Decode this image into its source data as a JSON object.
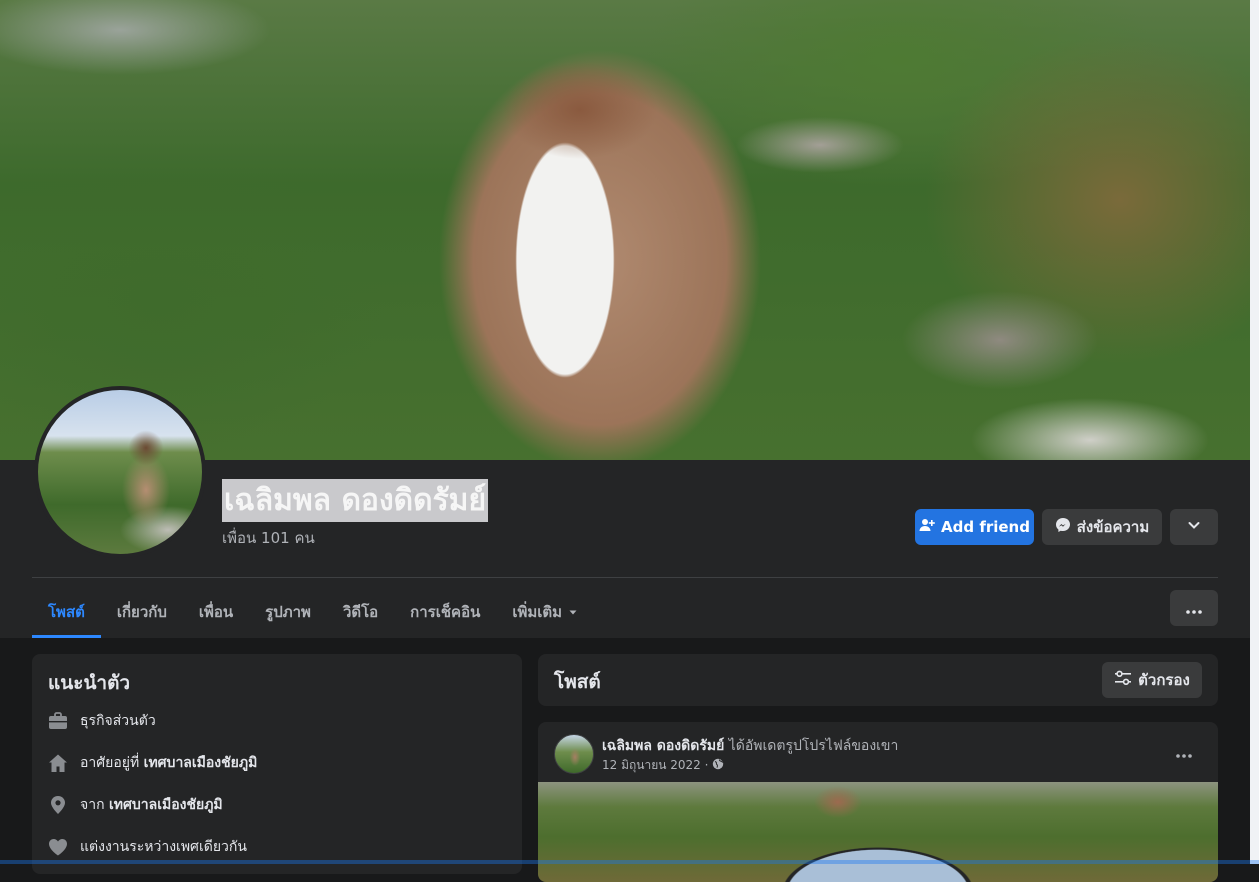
{
  "profile": {
    "name": "เฉลิมพล ดองดิดรัมย์",
    "friends_count": "เพื่อน 101 คน"
  },
  "actions": {
    "add_friend": "Add friend",
    "message": "ส่งข้อความ"
  },
  "tabs": [
    {
      "label": "โพสต์",
      "active": true
    },
    {
      "label": "เกี่ยวกับ"
    },
    {
      "label": "เพื่อน"
    },
    {
      "label": "รูปภาพ"
    },
    {
      "label": "วิดีโอ"
    },
    {
      "label": "การเช็คอิน"
    },
    {
      "label": "เพิ่มเติม"
    }
  ],
  "intro": {
    "title": "แนะนำตัว",
    "items": [
      {
        "icon": "briefcase-icon",
        "text": "ธุรกิจส่วนตัว",
        "bold": ""
      },
      {
        "icon": "home-icon",
        "text": "อาศัยอยู่ที่ ",
        "bold": "เทศบาลเมืองชัยภูมิ"
      },
      {
        "icon": "location-pin-icon",
        "text": "จาก ",
        "bold": "เทศบาลเมืองชัยภูมิ"
      },
      {
        "icon": "heart-icon",
        "text": "แต่งงานระหว่างเพศเดียวกัน",
        "bold": ""
      }
    ]
  },
  "posts_header": {
    "title": "โพสต์",
    "filter_label": "ตัวกรอง"
  },
  "post": {
    "author": "เฉลิมพล ดองดิดรัมย์",
    "action": " ได้อัพเดตรูปโปรไฟล์ของเขา",
    "date": "12 มิถุนายน 2022 ·"
  },
  "colors": {
    "accent": "#2374e1",
    "active_tab": "#2d88ff",
    "surface": "#242526",
    "background": "#18191a"
  }
}
